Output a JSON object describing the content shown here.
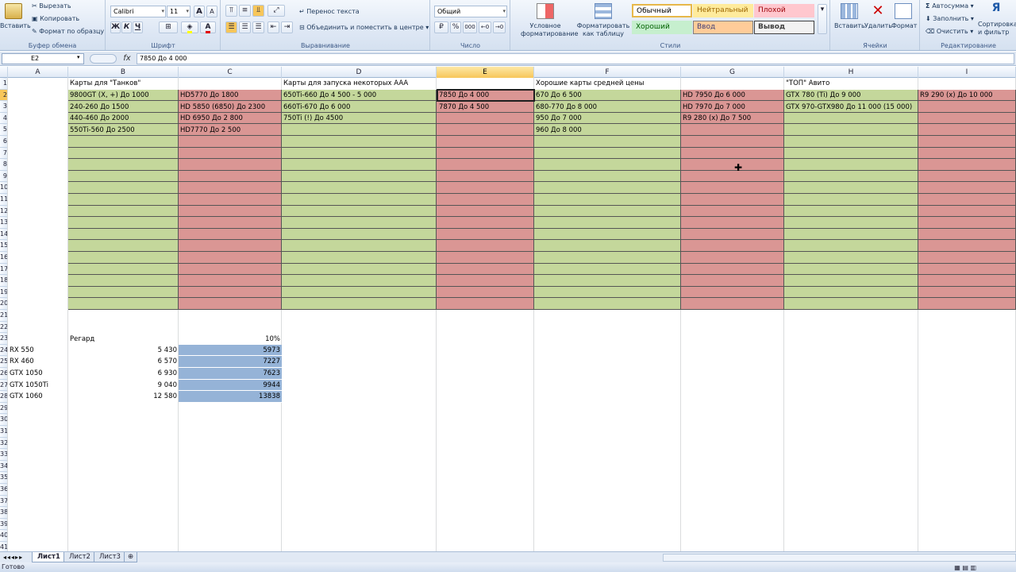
{
  "ribbon": {
    "clipboard": {
      "paste_label": "Вставить",
      "cut_label": "Вырезать",
      "copy_label": "Копировать",
      "format_painter_label": "Формат по образцу",
      "group_label": "Буфер обмена"
    },
    "font": {
      "font_name": "Calibri",
      "font_size": "11",
      "bold": "Ж",
      "italic": "К",
      "underline": "Ч",
      "grow": "A",
      "shrink": "A",
      "font_color_glyph": "A",
      "group_label": "Шрифт"
    },
    "alignment": {
      "wrap_text_label": "Перенос текста",
      "merge_label": "Объединить и поместить в центре",
      "group_label": "Выравнивание"
    },
    "number": {
      "format_value": "Общий",
      "percent": "%",
      "thousands": "000",
      "group_label": "Число"
    },
    "styles": {
      "conditional_label_1": "Условное",
      "conditional_label_2": "форматирование",
      "table_label_1": "Форматировать",
      "table_label_2": "как таблицу",
      "normal": "Обычный",
      "neutral": "Нейтральный",
      "bad": "Плохой",
      "good": "Хороший",
      "input": "Ввод",
      "output": "Вывод",
      "group_label": "Стили"
    },
    "cells": {
      "insert_label": "Вставить",
      "delete_label": "Удалить",
      "format_label": "Формат",
      "group_label": "Ячейки"
    },
    "editing": {
      "autosum_label": "Автосумма",
      "fill_label": "Заполнить",
      "clear_label": "Очистить",
      "sort_label_1": "Сортировка",
      "sort_label_2": "и фильтр",
      "group_label": "Редактирование"
    }
  },
  "formula_bar": {
    "name_box": "E2",
    "fx": "fx",
    "value": "7850 До 4 000"
  },
  "columns": [
    "A",
    "B",
    "C",
    "D",
    "E",
    "F",
    "G",
    "H",
    "I"
  ],
  "rows": [
    "1",
    "2",
    "3",
    "4",
    "5",
    "6",
    "7",
    "8",
    "9",
    "10",
    "11",
    "12",
    "13",
    "14",
    "15",
    "16",
    "17",
    "18",
    "19",
    "20",
    "21",
    "22",
    "23",
    "24",
    "25",
    "26",
    "27",
    "28",
    "29",
    "30",
    "31",
    "32",
    "33",
    "34",
    "35",
    "36",
    "37",
    "38",
    "39",
    "40",
    "41"
  ],
  "headers": {
    "b1": "Карты для \"Танков\"",
    "d1": "Карты для запуска некоторых AAA",
    "f1": "Хорошие карты средней цены",
    "h1": "\"ТОП\" Авито"
  },
  "cells": {
    "b2": "9800GT (X, +)    До 1000",
    "b3": "240-260     До 1500",
    "b4": "440-460     До 2000",
    "b5": "550Ti-560    До 2500",
    "c2": "HD5770  До 1800",
    "c3": "HD 5850 (6850) До 2300",
    "c4": "HD 6950  До 2 800",
    "c5": "HD7770  До 2 500",
    "d2": "650Ti-660  До 4 500 - 5 000",
    "d3": "660Ti-670  До 6 000",
    "d4": "750Ti (!) До 4500",
    "e2": "7850 До 4 000",
    "e3": "7870 До 4 500",
    "f2": "670  До 6 500",
    "f3": "680-770  До 8 000",
    "f4": "950  До 7 000",
    "f5": "960  До 8 000",
    "g2": "HD 7950  До 6 000",
    "g3": "HD 7970  До 7 000",
    "g4": "R9 280 (x)  До 7 500",
    "h2": "GTX 780 (Ti)  До 9 000",
    "h3": "GTX 970-GTX980   До 11 000 (15 000)",
    "i2": "R9 290 (x)  До 10 000"
  },
  "regard": {
    "label": "Регард",
    "percent": "10%",
    "items": [
      {
        "name": "RX 550",
        "price": "5 430",
        "plus": "5973"
      },
      {
        "name": "RX 460",
        "price": "6 570",
        "plus": "7227"
      },
      {
        "name": "GTX 1050",
        "price": "6 930",
        "plus": "7623"
      },
      {
        "name": "GTX 1050Ti",
        "price": "9 040",
        "plus": "9944"
      },
      {
        "name": "GTX 1060",
        "price": "12 580",
        "plus": "13838"
      }
    ]
  },
  "sheets": [
    "Лист1",
    "Лист2",
    "Лист3"
  ],
  "status": "Готово",
  "colors": {
    "green": "#c4d79b",
    "red": "#da9694",
    "blue": "#95b3d7",
    "selected_header": "#f7c65a"
  }
}
